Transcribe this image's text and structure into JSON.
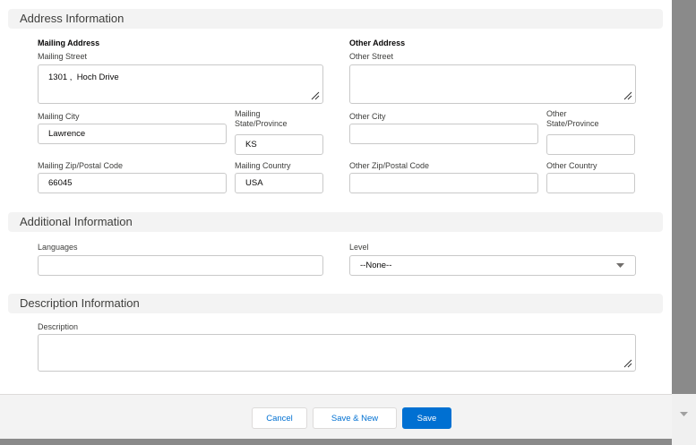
{
  "sections": {
    "address": {
      "title": "Address Information",
      "mailing": {
        "heading": "Mailing Address",
        "street_label": "Mailing Street",
        "street_value": "1301 ,  Hoch Drive",
        "city_label": "Mailing City",
        "city_value": "Lawrence",
        "state_label_line1": "Mailing",
        "state_label_line2": "State/Province",
        "state_value": "KS",
        "zip_label": "Mailing Zip/Postal Code",
        "zip_value": "66045",
        "country_label": "Mailing Country",
        "country_value": "USA"
      },
      "other": {
        "heading": "Other Address",
        "street_label": "Other Street",
        "street_value": "",
        "city_label": "Other City",
        "city_value": "",
        "state_label_line1": "Other",
        "state_label_line2": "State/Province",
        "state_value": "",
        "zip_label": "Other Zip/Postal Code",
        "zip_value": "",
        "country_label": "Other Country",
        "country_value": ""
      }
    },
    "additional": {
      "title": "Additional Information",
      "languages_label": "Languages",
      "languages_value": "",
      "level_label": "Level",
      "level_value": "--None--"
    },
    "description": {
      "title": "Description Information",
      "description_label": "Description",
      "description_value": ""
    }
  },
  "footer": {
    "cancel_label": "Cancel",
    "save_new_label": "Save & New",
    "save_label": "Save"
  },
  "colors": {
    "brand": "#0070d2",
    "section_bg": "#f3f3f3",
    "border": "#c9c9c9",
    "scrollbar": "#8a8a8a"
  }
}
